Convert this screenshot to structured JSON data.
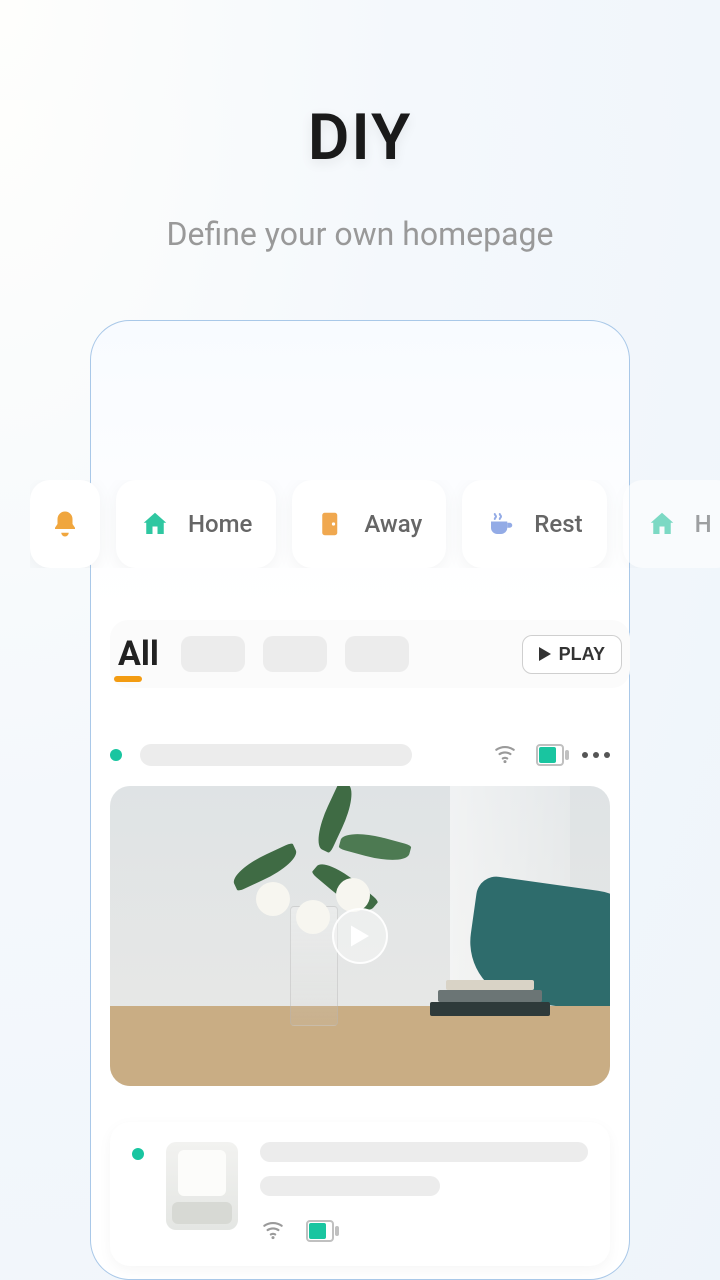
{
  "header": {
    "title": "DIY",
    "subtitle": "Define your own homepage"
  },
  "quick": {
    "items": [
      {
        "icon": "bell-icon",
        "label": ""
      },
      {
        "icon": "home-icon",
        "label": "Home"
      },
      {
        "icon": "door-icon",
        "label": "Away"
      },
      {
        "icon": "cup-icon",
        "label": "Rest"
      },
      {
        "icon": "home-icon",
        "label": "H"
      }
    ]
  },
  "tabs": {
    "active_label": "All",
    "play_label": "PLAY"
  },
  "colors": {
    "accent_teal": "#19c5a0",
    "accent_orange": "#f39c12",
    "door_orange": "#f0a84f",
    "cup_blue": "#93abe6"
  }
}
